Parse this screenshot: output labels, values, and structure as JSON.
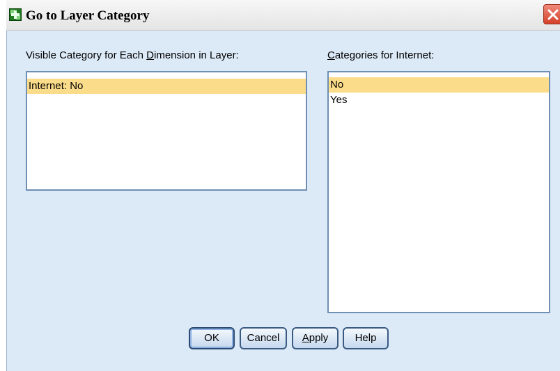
{
  "window": {
    "title": "Go to Layer Category"
  },
  "left_panel": {
    "label_pre": "Visible Category for Each ",
    "label_mnemonic": "D",
    "label_post": "imension in Layer:",
    "items": [
      {
        "label": "Internet: No",
        "selected": true
      }
    ]
  },
  "right_panel": {
    "label_mnemonic": "C",
    "label_post": "ategories for Internet:",
    "items": [
      {
        "label": "No",
        "selected": true
      },
      {
        "label": "Yes",
        "selected": false
      }
    ]
  },
  "buttons": {
    "ok": "OK",
    "cancel": "Cancel",
    "apply_mnemonic": "A",
    "apply_post": "pply",
    "help": "Help"
  },
  "colors": {
    "selection": "#fbdc8a",
    "dialog_bg": "#dce9f7",
    "close_button": "#d3402a"
  }
}
